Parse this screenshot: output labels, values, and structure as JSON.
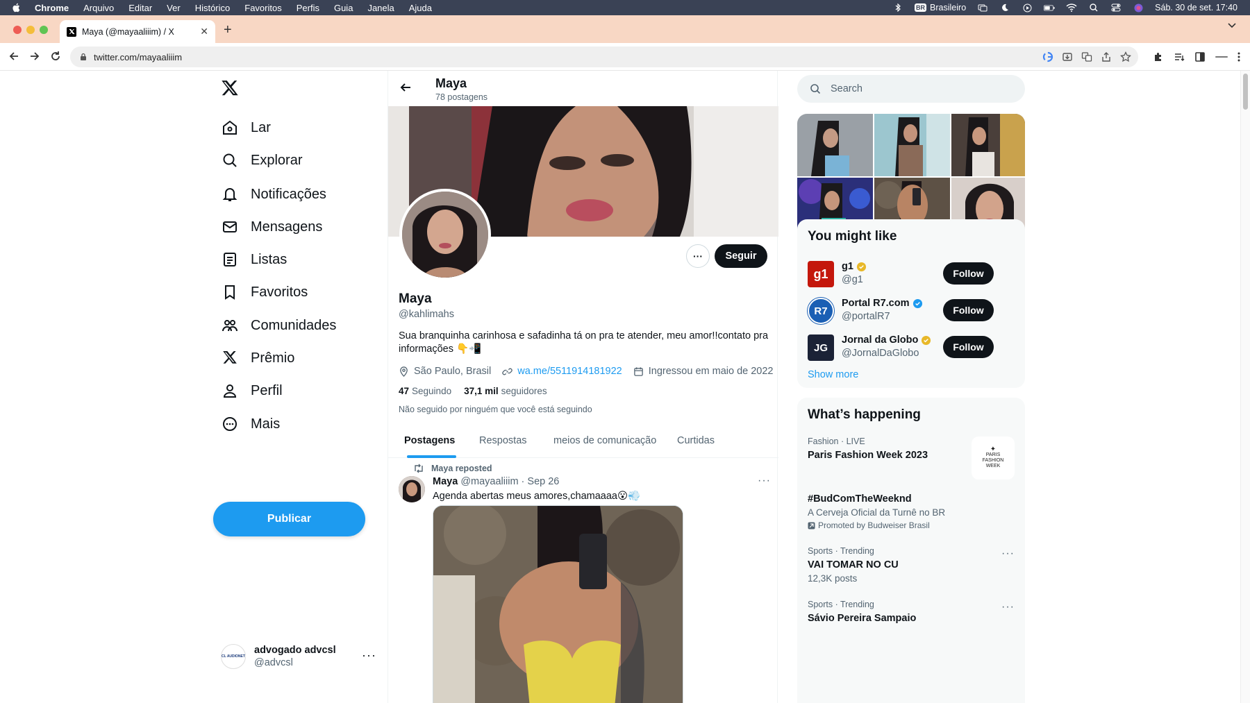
{
  "menubar": {
    "app": "Chrome",
    "menus": [
      "Arquivo",
      "Editar",
      "Ver",
      "Histórico",
      "Favoritos",
      "Perfis",
      "Guia",
      "Janela",
      "Ajuda"
    ],
    "keyboard_badge": "BR",
    "keyboard": "Brasileiro",
    "datetime": "Sáb. 30 de set.  17:40"
  },
  "browser": {
    "tab_title": "Maya (@mayaaliiim) / X",
    "url": "twitter.com/mayaaliiim"
  },
  "nav": {
    "items": [
      "Lar",
      "Explorar",
      "Notificações",
      "Mensagens",
      "Listas",
      "Favoritos",
      "Comunidades",
      "Prêmio",
      "Perfil",
      "Mais"
    ],
    "publish": "Publicar"
  },
  "account": {
    "name": "advogado advcsl",
    "handle": "@advcsl",
    "avatar_text": "CL AUDIONET"
  },
  "profile": {
    "header_name": "Maya",
    "post_count": "78 postagens",
    "name": "Maya",
    "handle": "@kahlimahs",
    "bio": "Sua branquinha carinhosa e safadinha tá on pra te atender, meu amor!!contato pra informações 👇📲",
    "location": "São Paulo, Brasil",
    "link": "wa.me/5511914181922",
    "joined": "Ingressou em maio de 2022",
    "following_count": "47",
    "following_label": "Seguindo",
    "followers_count": "37,1 mil",
    "followers_label": "seguidores",
    "follow_note": "Não seguido por ninguém que você está seguindo",
    "follow_button": "Seguir"
  },
  "tabs": [
    "Postagens",
    "Respostas",
    "meios de comunicação",
    "Curtidas"
  ],
  "post": {
    "repost_label": "Maya reposted",
    "author": "Maya",
    "handle_date": "@mayaaliiim · Sep 26",
    "text": "Agenda abertas meus amores,chamaaaa😮💨"
  },
  "sidebar": {
    "search_placeholder": "Search",
    "you_might_like_title": "You might like",
    "suggestions": [
      {
        "name": "g1",
        "handle": "@g1",
        "logo": "g1",
        "logo_color": "#c4170c",
        "follow": "Follow",
        "badge_color": "#e8b829"
      },
      {
        "name": "Portal R7.com",
        "handle": "@portalR7",
        "logo": "R7",
        "logo_color": "#1a5fb4",
        "follow": "Follow",
        "badge_color": "#1d9bf0"
      },
      {
        "name": "Jornal da Globo",
        "handle": "@JornalDaGlobo",
        "logo": "JG",
        "logo_color": "#1b2236",
        "follow": "Follow",
        "badge_color": "#e8b829"
      }
    ],
    "show_more": "Show more",
    "whats_happening_title": "What’s happening",
    "trends": [
      {
        "meta": "Fashion · LIVE",
        "title": "Paris Fashion Week 2023",
        "thumb": "PARIS FASHION WEEK"
      },
      {
        "meta": "",
        "title": "#BudComTheWeeknd",
        "sub": "A Cerveja Oficial da Turnê no BR",
        "promo": "Promoted by Budweiser Brasil"
      },
      {
        "meta": "Sports · Trending",
        "title": "VAI TOMAR NO CU",
        "sub": "12,3K posts"
      },
      {
        "meta": "Sports · Trending",
        "title": "Sávio Pereira Sampaio"
      }
    ]
  }
}
